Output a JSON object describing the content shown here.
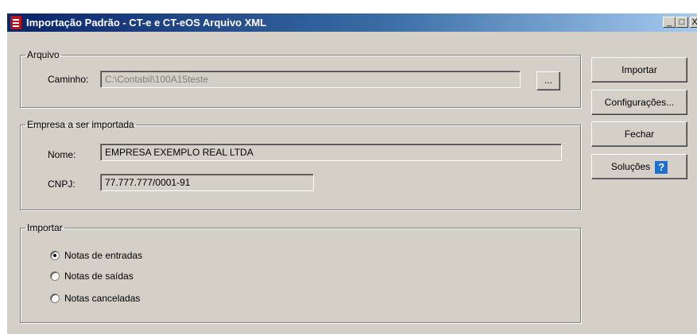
{
  "window": {
    "title": "Importação Padrão - CT-e e CT-eOS Arquivo XML",
    "controls": {
      "minimize": "_",
      "maximize": "□",
      "close": "X"
    }
  },
  "arquivo": {
    "legend": "Arquivo",
    "caminho_label": "Caminho:",
    "caminho_value": "C:\\Contabil\\100A15teste",
    "browse_label": "..."
  },
  "empresa": {
    "legend": "Empresa a ser importada",
    "nome_label": "Nome:",
    "nome_value": "EMPRESA EXEMPLO REAL LTDA",
    "cnpj_label": "CNPJ:",
    "cnpj_value": "77.777.777/0001-91"
  },
  "importar": {
    "legend": "Importar",
    "options": [
      {
        "label": "Notas de entradas",
        "selected": true
      },
      {
        "label": "Notas de saídas",
        "selected": false
      },
      {
        "label": "Notas canceladas",
        "selected": false
      }
    ]
  },
  "buttons": {
    "importar": "Importar",
    "configuracoes": "Configurações...",
    "fechar": "Fechar",
    "solucoes": "Soluções",
    "solucoes_icon": "help-icon"
  },
  "colors": {
    "titlebar_start": "#0a246a",
    "titlebar_end": "#a6caf0",
    "window_face": "#d4d0c8",
    "help_icon": "#1f6fd1"
  }
}
